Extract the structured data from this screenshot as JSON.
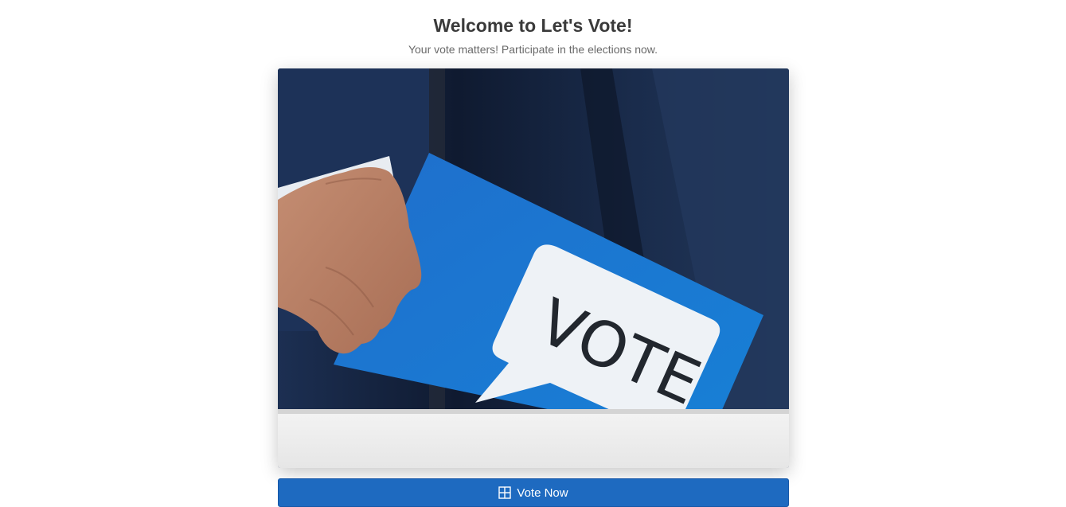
{
  "header": {
    "title": "Welcome to Let's Vote!",
    "subtitle": "Your vote matters! Participate in the elections now."
  },
  "hero": {
    "ballot_text": "VOTE",
    "colors": {
      "ballot": "#1b78d0",
      "suit": "#14233e",
      "box": "#ececec"
    }
  },
  "cta": {
    "label": "Vote Now",
    "icon": "grid-icon",
    "color": "#1e6ac0"
  }
}
